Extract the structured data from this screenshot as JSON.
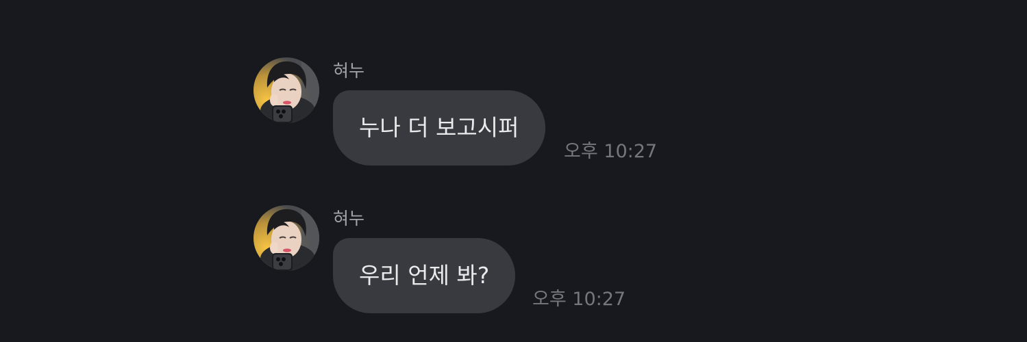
{
  "colors": {
    "background": "#18191e",
    "bubble": "#393a3f",
    "message_text": "#ebebed",
    "sender_text": "#a4a5ab",
    "time_text": "#76777d"
  },
  "messages": [
    {
      "sender": "혀누",
      "avatar_icon": "profile-photo-icon",
      "text": "누나 더 보고시퍼",
      "time": "오후 10:27"
    },
    {
      "sender": "혀누",
      "avatar_icon": "profile-photo-icon",
      "text": "우리 언제 봐?",
      "time": "오후 10:27"
    }
  ]
}
